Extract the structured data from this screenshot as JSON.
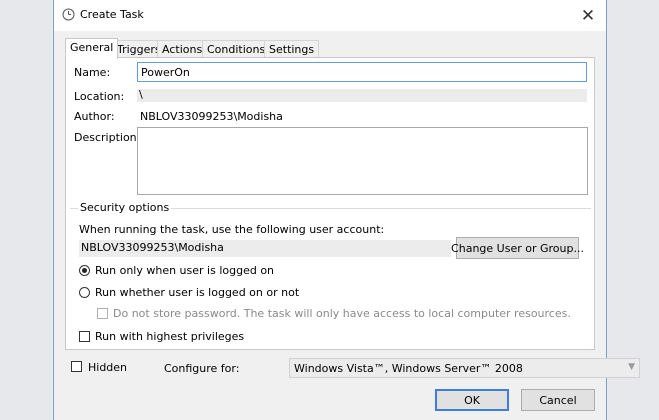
{
  "window": {
    "title": "Create Task",
    "close_label": "✕"
  },
  "tabs": [
    {
      "label": "General"
    },
    {
      "label": "Triggers"
    },
    {
      "label": "Actions"
    },
    {
      "label": "Conditions"
    },
    {
      "label": "Settings"
    }
  ],
  "general": {
    "name_label": "Name:",
    "name_value": "PowerOn",
    "location_label": "Location:",
    "location_value": "\\",
    "author_label": "Author:",
    "author_value": "NBLOV33099253\\Modisha",
    "description_label": "Description:"
  },
  "security": {
    "group_label": "Security options",
    "account_prompt": "When running the task, use the following user account:",
    "account_value": "NBLOV33099253\\Modisha",
    "change_button": "Change User or Group...",
    "radio_logged_on": "Run only when user is logged on",
    "radio_whether": "Run whether user is logged on or not",
    "no_store_password": "Do not store password.  The task will only have access to local computer resources.",
    "highest_privileges": "Run with highest privileges"
  },
  "footer": {
    "hidden_label": "Hidden",
    "configure_label": "Configure for:",
    "configure_value": "Windows Vista™, Windows Server™ 2008",
    "ok_button": "OK",
    "cancel_button": "Cancel"
  }
}
